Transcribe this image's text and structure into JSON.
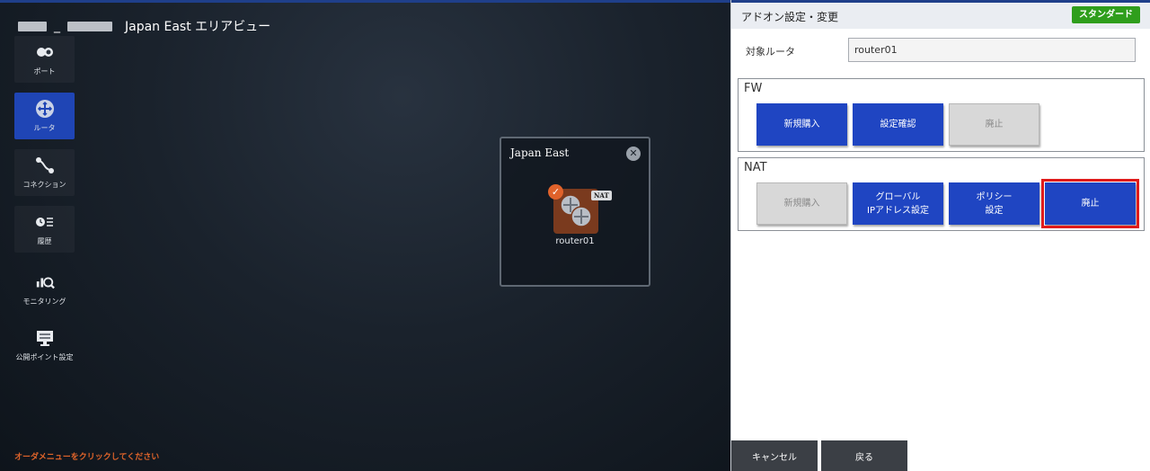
{
  "area": {
    "title": "Japan East エリアビュー",
    "separator": "_"
  },
  "sidebar": {
    "items": [
      {
        "label": "ポート",
        "icon": "port-icon"
      },
      {
        "label": "ルータ",
        "icon": "router-icon"
      },
      {
        "label": "コネクション",
        "icon": "connection-icon"
      },
      {
        "label": "履歴",
        "icon": "history-icon"
      },
      {
        "label": "モニタリング",
        "icon": "monitoring-icon"
      },
      {
        "label": "公開ポイント設定",
        "icon": "public-point-icon"
      }
    ]
  },
  "hint": "オーダメニューをクリックしてください",
  "region_card": {
    "title": "Japan East",
    "router_name": "router01",
    "tag": "NAT"
  },
  "panel": {
    "title": "アドオン設定・変更",
    "plan_badge": "スタンダード",
    "target_label": "対象ルータ",
    "target_value": "router01",
    "fw": {
      "title": "FW",
      "buttons": [
        "新規購入",
        "設定確認",
        "廃止"
      ]
    },
    "nat": {
      "title": "NAT",
      "buttons": [
        "新規購入",
        "グローバル\nIPアドレス設定",
        "ポリシー\n設定",
        "廃止"
      ]
    },
    "footer": {
      "cancel": "キャンセル",
      "back": "戻る"
    }
  },
  "colors": {
    "accent_blue": "#1f45c2",
    "plan_green": "#2f9e1c",
    "hint_orange": "#e0642a",
    "highlight_red": "#e01b1b"
  }
}
